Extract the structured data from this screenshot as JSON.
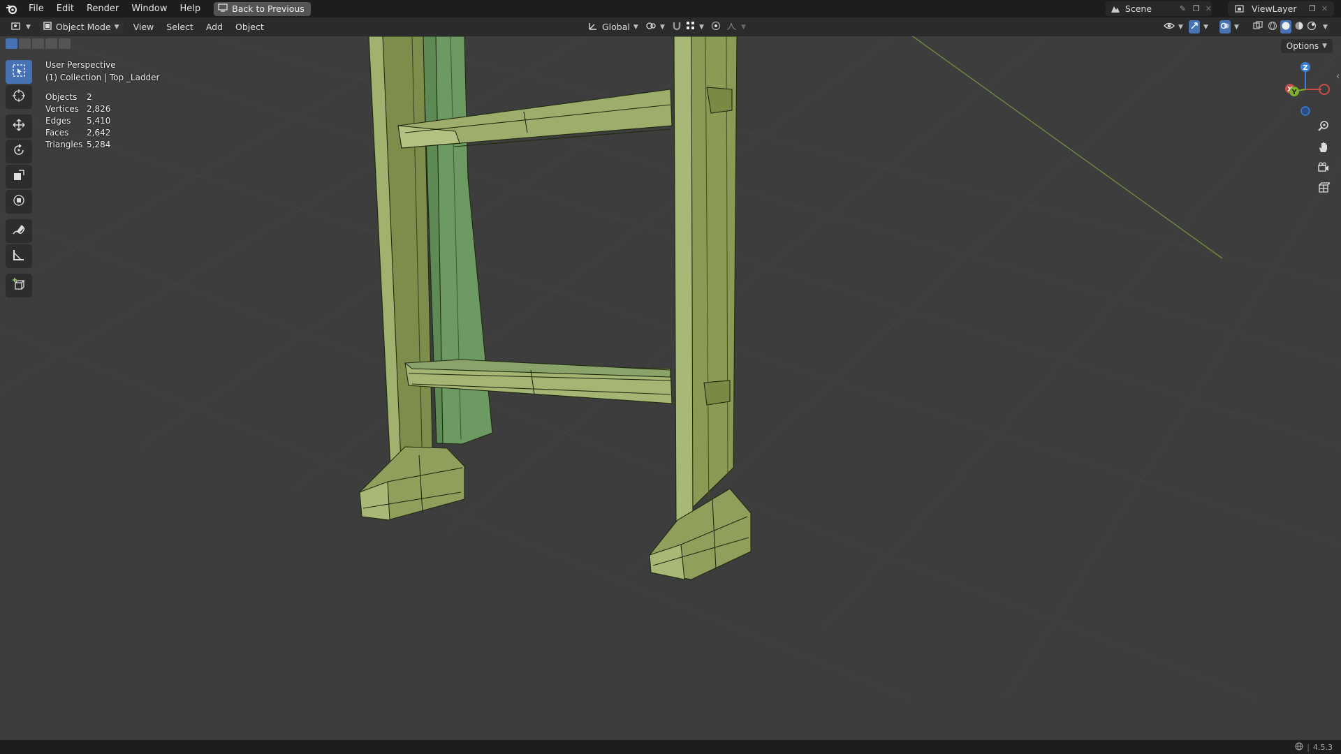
{
  "menu": {
    "items": [
      "File",
      "Edit",
      "Render",
      "Window",
      "Help"
    ],
    "back_label": "Back to Previous"
  },
  "scene": {
    "label": "Scene"
  },
  "view_layer": {
    "label": "ViewLayer"
  },
  "header": {
    "mode": "Object Mode",
    "menus": [
      "View",
      "Select",
      "Add",
      "Object"
    ],
    "orientation": "Global"
  },
  "viewport": {
    "perspective": "User Perspective",
    "collection": "(1) Collection | Top _Ladder",
    "stats": [
      {
        "label": "Objects",
        "value": "2"
      },
      {
        "label": "Vertices",
        "value": "2,826"
      },
      {
        "label": "Edges",
        "value": "5,410"
      },
      {
        "label": "Faces",
        "value": "2,642"
      },
      {
        "label": "Triangles",
        "value": "5,284"
      }
    ],
    "options_label": "Options"
  },
  "gizmo": {
    "z": "Z",
    "y": "Y",
    "x": "X"
  },
  "status": {
    "version": "4.5.3"
  },
  "colors": {
    "accent": "#4772b3",
    "model": "#8fa65e",
    "background": "#3d3d3d"
  },
  "icons": [
    "blender-logo",
    "select-box-icon",
    "cursor-icon",
    "move-icon",
    "rotate-icon",
    "scale-icon",
    "transform-icon",
    "annotate-icon",
    "measure-icon",
    "add-cube-icon",
    "zoom-icon",
    "hand-icon",
    "camera-icon",
    "grid-icon"
  ]
}
